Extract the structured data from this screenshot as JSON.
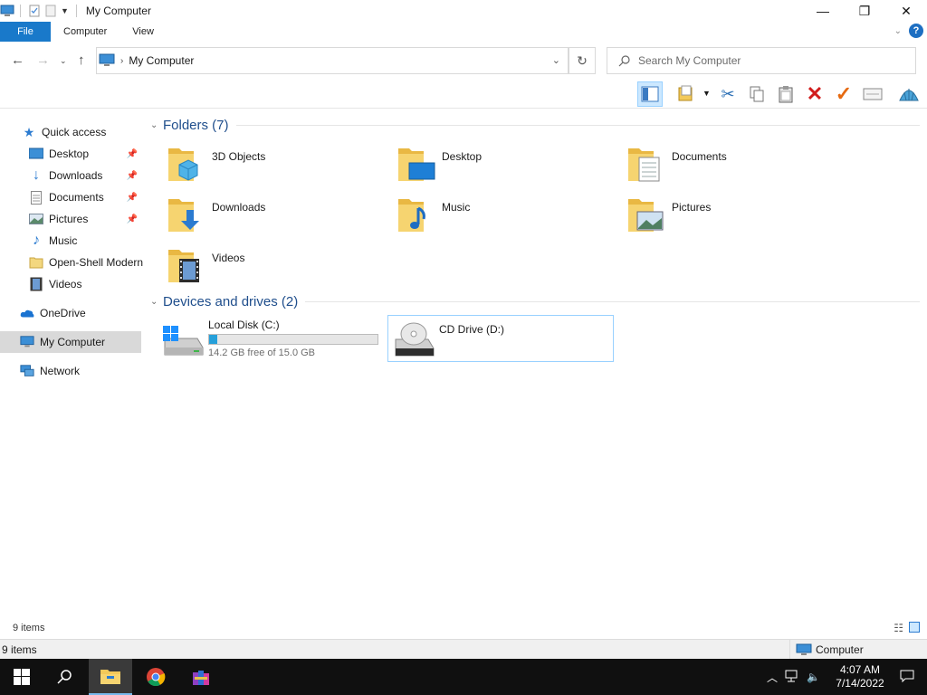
{
  "window": {
    "title": "My Computer"
  },
  "ribbon": {
    "file_tab": "File",
    "tabs": [
      "Computer",
      "View"
    ]
  },
  "address": {
    "path": "My Computer"
  },
  "search": {
    "placeholder": "Search My Computer"
  },
  "sidebar": {
    "quick_access": "Quick access",
    "quick_items": [
      {
        "label": "Desktop",
        "pinned": true
      },
      {
        "label": "Downloads",
        "pinned": true
      },
      {
        "label": "Documents",
        "pinned": true
      },
      {
        "label": "Pictures",
        "pinned": true
      },
      {
        "label": "Music",
        "pinned": false
      },
      {
        "label": "Open-Shell Modern",
        "pinned": false
      },
      {
        "label": "Videos",
        "pinned": false
      }
    ],
    "onedrive": "OneDrive",
    "my_computer": "My Computer",
    "network": "Network"
  },
  "folders": {
    "header": "Folders (7)",
    "items": [
      "3D Objects",
      "Desktop",
      "Documents",
      "Downloads",
      "Music",
      "Pictures",
      "Videos"
    ]
  },
  "drives": {
    "header": "Devices and drives (2)",
    "items": [
      {
        "name": "Local Disk (C:)",
        "free": "14.2 GB free of 15.0 GB",
        "used_fraction": 0.05
      },
      {
        "name": "CD Drive (D:)"
      }
    ]
  },
  "status": {
    "items_count": "9 items",
    "items_count2": "9 items",
    "location": "Computer"
  },
  "taskbar": {
    "time": "4:07 AM",
    "date": "7/14/2022"
  },
  "colors": {
    "accent": "#1979ca",
    "folder": "#f3c95a",
    "selection": "#cce8ff",
    "taskbar": "#101010"
  }
}
